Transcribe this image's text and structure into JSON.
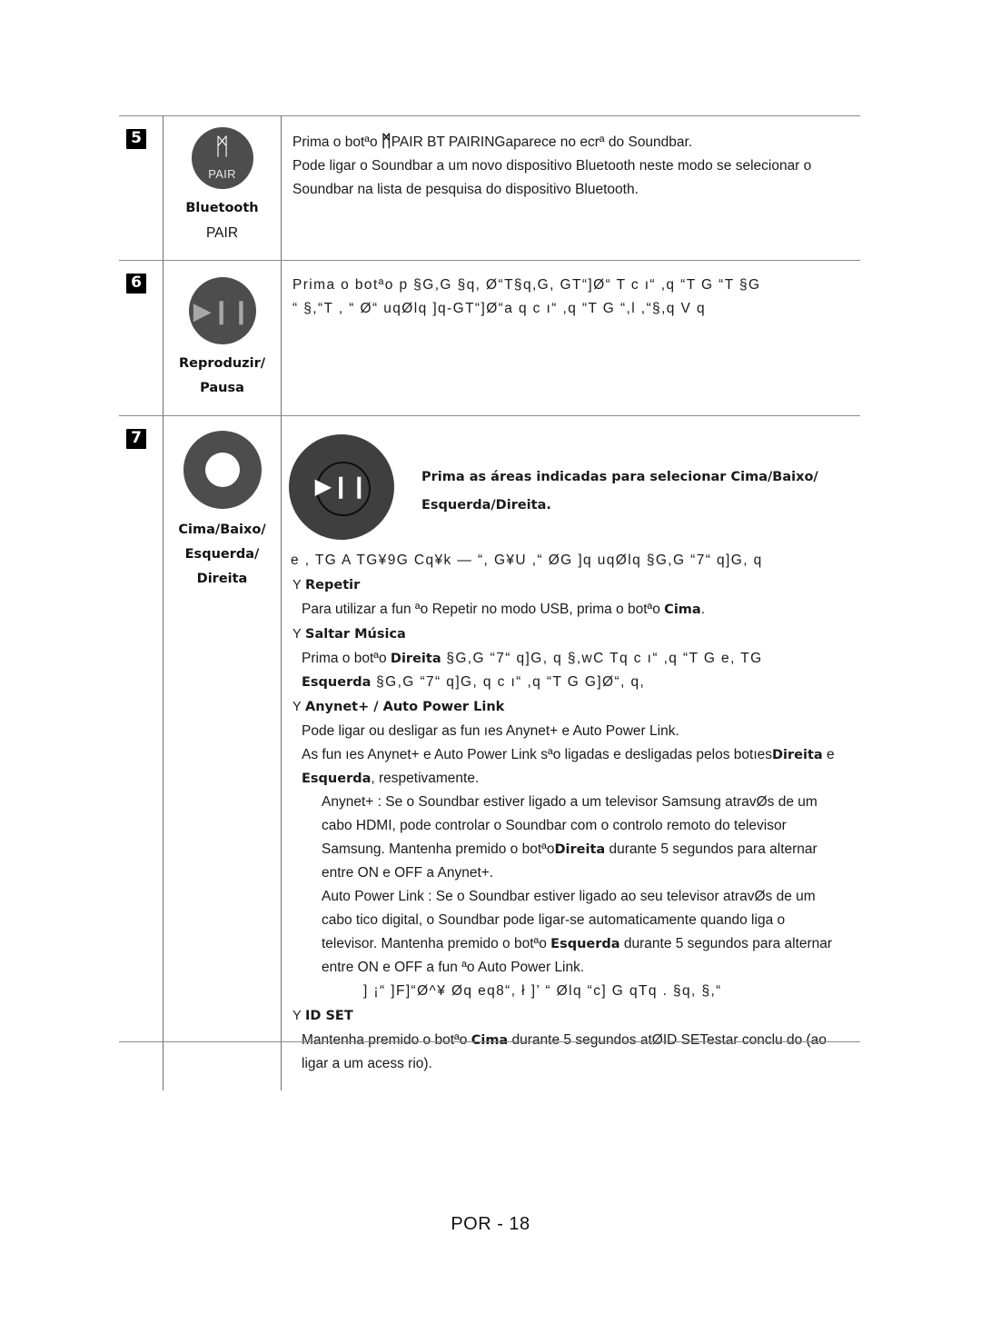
{
  "document": {
    "footer": "POR - 18"
  },
  "rows": [
    {
      "number": "5",
      "icon": {
        "name": "bluetooth-pair-button",
        "glyph": "ᛗ",
        "sub_label": "PAIR"
      },
      "captions": [
        "Bluetooth",
        "PAIR"
      ],
      "lines": [
        {
          "kind": "mixed",
          "parts": [
            {
              "text": "Prima o botªo ",
              "bold": false
            },
            {
              "text": "ᛗ",
              "bold": false,
              "icon": true
            },
            {
              "text": "PAIR",
              "bold": false
            },
            {
              "text": "  BT PAIRINGaparece no ecrª do Soundbar.",
              "bold": false
            }
          ]
        },
        {
          "kind": "plain",
          "text": "Pode ligar o Soundbar a um novo dispositivo Bluetooth neste modo se selecionar o"
        },
        {
          "kind": "plain",
          "text": "Soundbar na lista de pesquisa do dispositivo Bluetooth."
        }
      ]
    },
    {
      "number": "6",
      "icon": {
        "name": "play-pause-button",
        "glyph": "▶❙❙"
      },
      "captions": [
        "Reproduzir/",
        "Pausa"
      ],
      "lines": [
        {
          "kind": "garbled",
          "text": "Prima o botªo p   §G,G §q, Ø“T§q,G, GT“]Ø“  T c ı“ ,q  “T    G “T §G"
        },
        {
          "kind": "garbled",
          "text": "“ §,“T , “ Ø“ uqØlq ]q-GT“]Ø“a q c ı“ ,q  “T    G “,l ,“§,q  V q"
        }
      ]
    },
    {
      "number": "7",
      "icon": {
        "name": "directional-pad-button"
      },
      "captions": [
        "Cima/Baixo/",
        "Esquerda/",
        "Direita"
      ],
      "diagram": {
        "button_glyph": "▶❙❙",
        "text_lines": [
          "Prima as áreas indicadas para selecionar Cima/Baixo/",
          "Esquerda/Direita."
        ]
      },
      "garbled_intro": "e , TG  A  TG¥9G  Cq¥k  — “, G¥U ,“ ØG ]q uqØlq §G,G  “7“  q]G, q",
      "sections": [
        {
          "heading": "Repetir",
          "bullet": "Y",
          "body": [
            {
              "kind": "mixed",
              "parts": [
                {
                  "text": "Para utilizar a fun ªo Repetir no modo  USB, prima o botªo ",
                  "bold": false
                },
                {
                  "text": "Cima",
                  "bold": true
                },
                {
                  "text": ".",
                  "bold": false
                }
              ]
            }
          ]
        },
        {
          "heading": "Saltar Música",
          "bullet": "Y",
          "body": [
            {
              "kind": "mixed-garbled",
              "parts": [
                {
                  "text": "Prima o botªo ",
                  "bold": false
                },
                {
                  "text": "Direita",
                  "bold": true
                },
                {
                  "text": " §G,G   “7“  q]G, q §,wC Tq c ı“ ,q  “T    G  e, TG",
                  "bold": false,
                  "garbled": true
                }
              ]
            },
            {
              "kind": "mixed-garbled",
              "parts": [
                {
                  "text": "Esquerda",
                  "bold": true
                },
                {
                  "text": " §G,G  “7“  q]G, q c ı“ ,q  “T    G G]Ø“, q,",
                  "bold": false,
                  "garbled": true
                }
              ]
            }
          ]
        },
        {
          "heading": "Anynet+ / Auto Power Link",
          "bullet": "Y",
          "body": [
            {
              "kind": "plain",
              "text": "Pode ligar ou desligar as fun ıes Anynet+ e Auto Power Link."
            },
            {
              "kind": "mixed",
              "parts": [
                {
                  "text": "As fun ıes Anynet+ e Auto Power Link sªo ligadas e desligadas pelos botıes",
                  "bold": false
                },
                {
                  "text": "Direita",
                  "bold": true
                },
                {
                  "text": " e",
                  "bold": false
                }
              ]
            },
            {
              "kind": "mixed",
              "parts": [
                {
                  "text": "Esquerda",
                  "bold": true
                },
                {
                  "text": ", respetivamente.",
                  "bold": false
                }
              ]
            }
          ],
          "subparagraphs": [
            {
              "lines": [
                {
                  "kind": "plain",
                  "text": "Anynet+ : Se o Soundbar estiver ligado a um televisor Samsung atravØs de um"
                },
                {
                  "kind": "plain",
                  "text": "cabo HDMI, pode controlar o Soundbar com o controlo remoto do televisor"
                },
                {
                  "kind": "mixed",
                  "parts": [
                    {
                      "text": "Samsung. Mantenha premido o botªo",
                      "bold": false
                    },
                    {
                      "text": "Direita",
                      "bold": true
                    },
                    {
                      "text": " durante 5 segundos para alternar",
                      "bold": false
                    }
                  ]
                },
                {
                  "kind": "plain",
                  "text": "entre ON e OFF a Anynet+."
                }
              ]
            },
            {
              "lines": [
                {
                  "kind": "plain",
                  "text": "Auto Power Link : Se o Soundbar estiver ligado ao seu televisor atravØs de um"
                },
                {
                  "kind": "plain",
                  "text": "cabo  tico digital, o Soundbar pode ligar-se automaticamente quando liga o"
                },
                {
                  "kind": "mixed",
                  "parts": [
                    {
                      "text": "televisor. Mantenha premido o botªo ",
                      "bold": false
                    },
                    {
                      "text": "Esquerda",
                      "bold": true
                    },
                    {
                      "text": " durante 5 segundos para alternar",
                      "bold": false
                    }
                  ]
                },
                {
                  "kind": "plain",
                  "text": "entre ON e OFF a fun ªo Auto Power Link."
                }
              ]
            }
          ]
        },
        {
          "heading": "ID SET",
          "bullet": "Y",
          "garbled_before": "] ¡“  ]F]“Ø^¥  Øq eq8“, ł ]’ “ Ølq  “c] G   qTq .  §q, §,“",
          "body": [
            {
              "kind": "mixed",
              "parts": [
                {
                  "text": "Mantenha premido o botªo ",
                  "bold": false
                },
                {
                  "text": "Cima",
                  "bold": true
                },
                {
                  "text": " durante 5 segundos atØ",
                  "bold": false
                },
                {
                  "text": "ID SET",
                  "bold": false
                },
                {
                  "text": "estar conclu do (ao",
                  "bold": false
                }
              ]
            },
            {
              "kind": "plain",
              "text": "ligar a um acess rio)."
            }
          ]
        }
      ]
    }
  ],
  "colors": {
    "button_fill": "#4d4d4d",
    "ring_fill": "#3f3f3f",
    "rule": "#8a8a8a",
    "text": "#1a1a1a"
  }
}
